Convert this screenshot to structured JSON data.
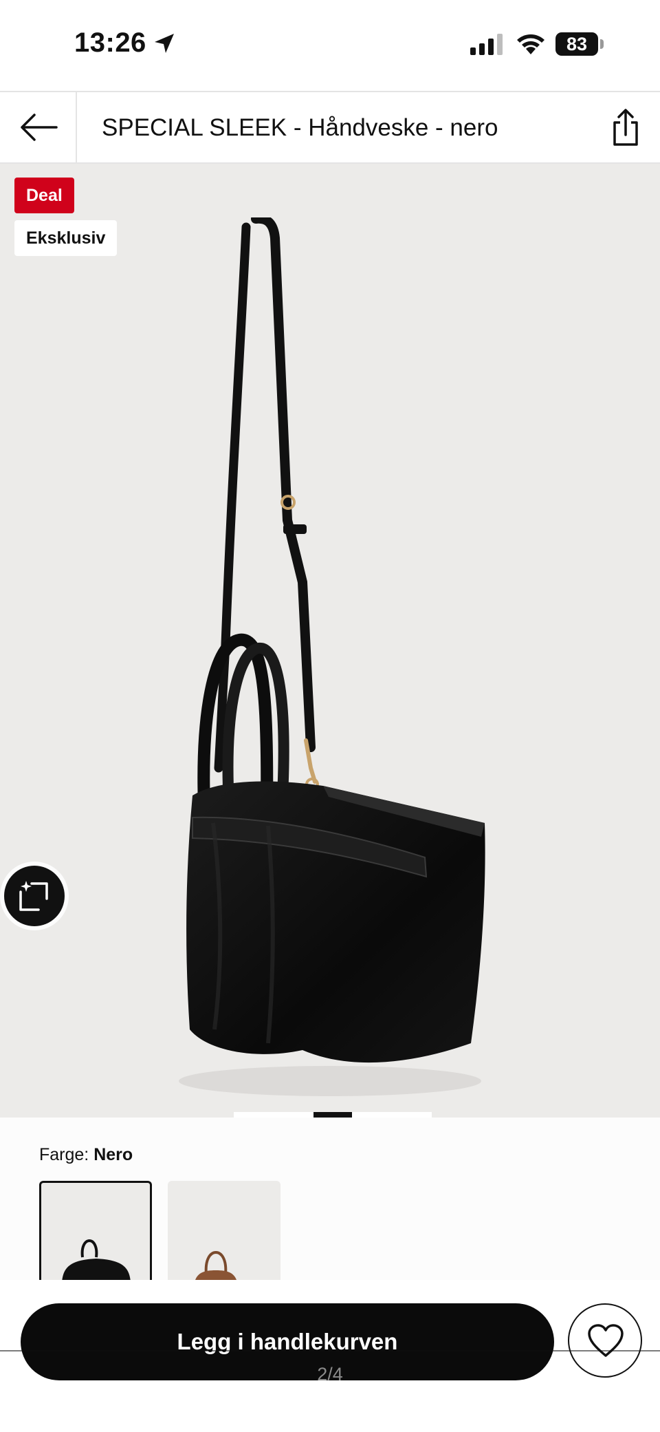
{
  "status_bar": {
    "time": "13:26",
    "battery": "83"
  },
  "nav": {
    "title": "SPECIAL SLEEK - Håndveske - nero"
  },
  "badges": {
    "deal": "Deal",
    "exclusive": "Eksklusiv"
  },
  "gallery": {
    "pages_total": 4,
    "current_page": 2
  },
  "color": {
    "label": "Farge:",
    "selected": "Nero",
    "swatches": [
      "Nero",
      "Brown"
    ]
  },
  "actions": {
    "add_to_cart": "Legg i handlekurven"
  },
  "pager_text": "2/4",
  "colors": {
    "deal": "#d0021b",
    "gallery_bg": "#ecebe9",
    "primary": "#0b0b0b"
  },
  "icons": {
    "back": "arrow-left-icon",
    "share": "share-icon",
    "compare": "sparkle-frame-icon",
    "wishlist": "heart-icon",
    "location": "location-arrow-icon"
  }
}
